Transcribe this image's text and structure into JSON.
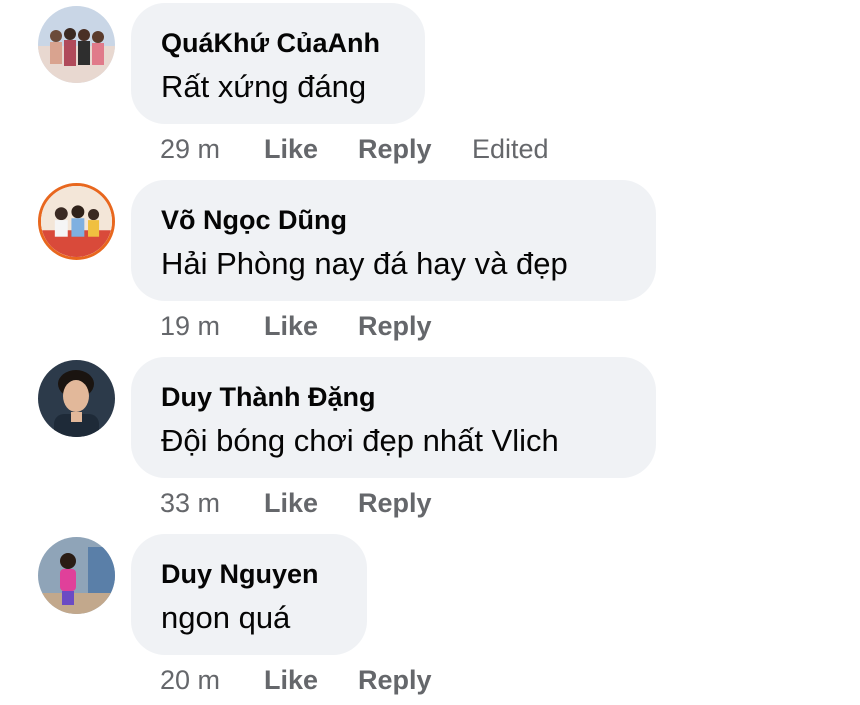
{
  "comments": [
    {
      "author": "QuáKhứ CủaAnh",
      "text": "Rất xứng đáng",
      "time": "29 m",
      "like": "Like",
      "reply": "Reply",
      "edited": "Edited"
    },
    {
      "author": "Võ Ngọc Dũng",
      "text": "Hải Phòng nay đá hay và đẹp",
      "time": "19 m",
      "like": "Like",
      "reply": "Reply"
    },
    {
      "author": "Duy Thành Đặng",
      "text": "Đội bóng chơi đẹp nhất Vlich",
      "time": "33 m",
      "like": "Like",
      "reply": "Reply"
    },
    {
      "author": "Duy Nguyen",
      "text": "ngon quá",
      "time": "20 m",
      "like": "Like",
      "reply": "Reply"
    }
  ],
  "colors": {
    "bubble": "#f0f2f5",
    "text": "#050505",
    "secondary": "#65676b"
  }
}
